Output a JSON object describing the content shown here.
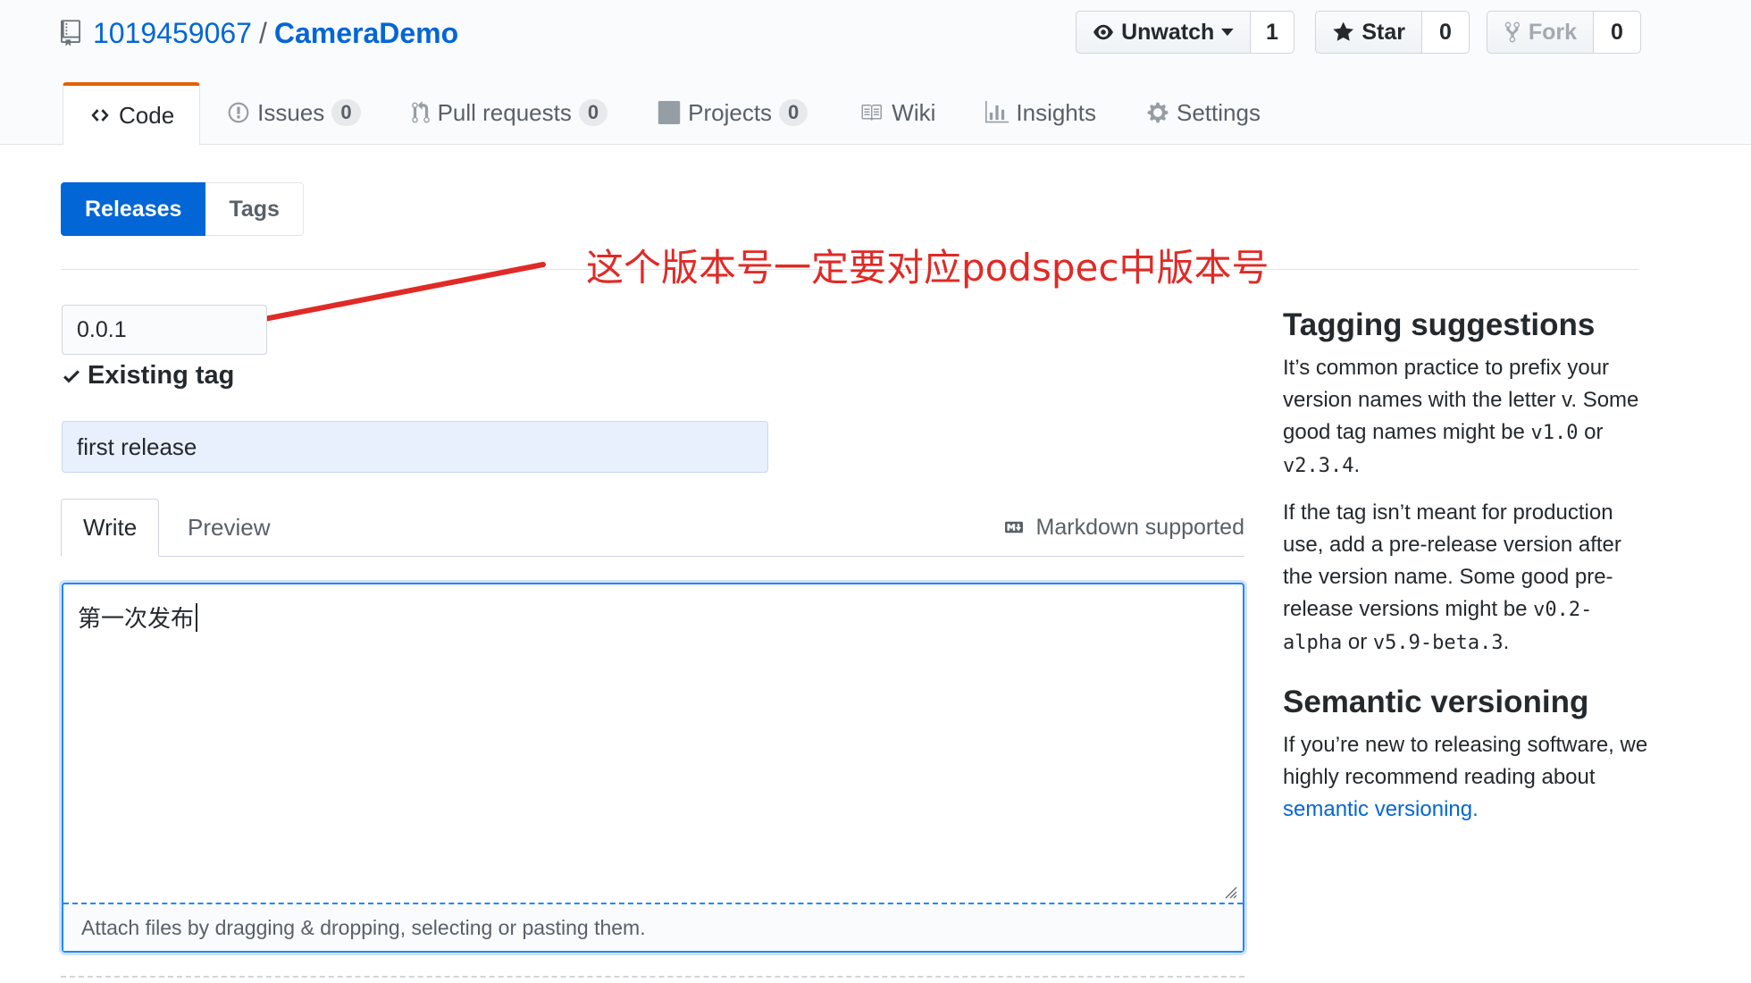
{
  "repo": {
    "owner": "1019459067",
    "separator": "/",
    "name": "CameraDemo"
  },
  "actions": {
    "watch": {
      "label": "Unwatch",
      "count": "1"
    },
    "star": {
      "label": "Star",
      "count": "0"
    },
    "fork": {
      "label": "Fork",
      "count": "0"
    }
  },
  "nav": {
    "code": "Code",
    "issues": {
      "label": "Issues",
      "count": "0"
    },
    "pulls": {
      "label": "Pull requests",
      "count": "0"
    },
    "projects": {
      "label": "Projects",
      "count": "0"
    },
    "wiki": "Wiki",
    "insights": "Insights",
    "settings": "Settings"
  },
  "subnav": {
    "releases": "Releases",
    "tags": "Tags"
  },
  "annotation": {
    "text": "这个版本号一定要对应podspec中版本号",
    "color": "#e02a26"
  },
  "form": {
    "tag_value": "0.0.1",
    "tag_status": "Existing tag",
    "title_value": "first release",
    "tab_write": "Write",
    "tab_preview": "Preview",
    "markdown_hint": "Markdown supported",
    "body_value": "第一次发布",
    "attach_hint": "Attach files by dragging & dropping, selecting or pasting them."
  },
  "sidebar": {
    "h1": "Tagging suggestions",
    "p1_a": "It’s common practice to prefix your version names with the letter v. Some good tag names might be ",
    "p1_code1": "v1.0",
    "p1_b": " or ",
    "p1_code2": "v2.3.4",
    "p1_c": ".",
    "p2_a": "If the tag isn’t meant for production use, add a pre-release version after the version name. Some good pre-release versions might be ",
    "p2_code1": "v0.2-alpha",
    "p2_b": " or ",
    "p2_code2": "v5.9-beta.3",
    "p2_c": ".",
    "h2": "Semantic versioning",
    "p3_a": "If you’re new to releasing software, we highly recommend reading about ",
    "p3_link": "semantic versioning."
  },
  "colors": {
    "accent": "#0366d6",
    "tab_highlight": "#e36209",
    "focus": "#2188ff"
  }
}
